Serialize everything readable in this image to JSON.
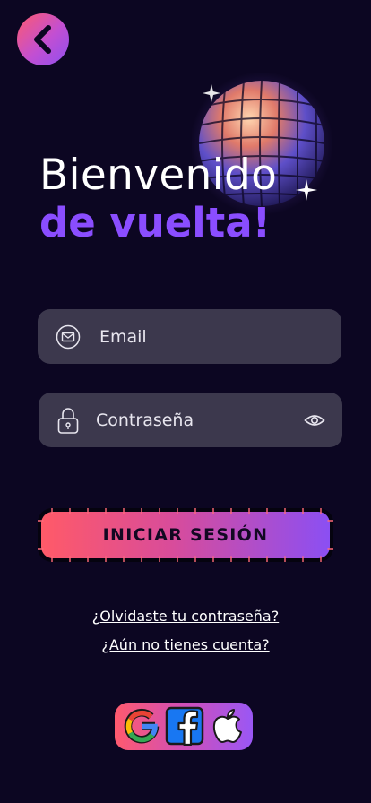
{
  "header": {
    "back_icon": "chevron-left-icon",
    "title_line1": "Bienvenido",
    "title_line2": "de vuelta!"
  },
  "form": {
    "email": {
      "placeholder": "Email",
      "value": "",
      "icon": "mail-icon"
    },
    "password": {
      "placeholder": "Contraseña",
      "value": "",
      "icon": "lock-icon",
      "toggle_icon": "eye-icon"
    },
    "submit_label": "INICIAR SESIÓN"
  },
  "links": {
    "forgot_password": "¿Olvidaste tu contraseña?",
    "no_account": "¿Aún no tienes cuenta?"
  },
  "social": {
    "providers": [
      "google",
      "facebook",
      "apple"
    ]
  },
  "colors": {
    "background": "#0c0622",
    "accent_purple": "#8a4dff",
    "accent_red": "#ff5a68",
    "field_background": "#3c384d"
  }
}
